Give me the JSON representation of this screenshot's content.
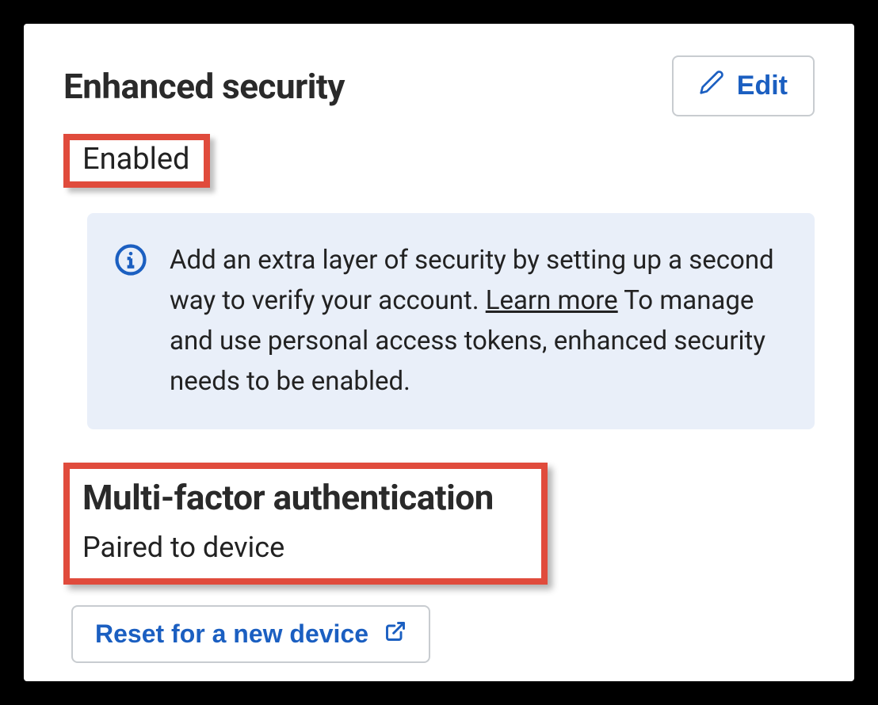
{
  "header": {
    "title": "Enhanced security",
    "edit_label": "Edit"
  },
  "status": {
    "label": "Enabled"
  },
  "info": {
    "text_part1": "Add an extra layer of security by setting up a second way to verify your account. ",
    "learn_more": "Learn more",
    "text_part2": " To manage and use personal access tokens, enhanced security needs to be enabled."
  },
  "mfa": {
    "title": "Multi-factor authentication",
    "status": "Paired to device",
    "reset_label": "Reset for a new device"
  }
}
